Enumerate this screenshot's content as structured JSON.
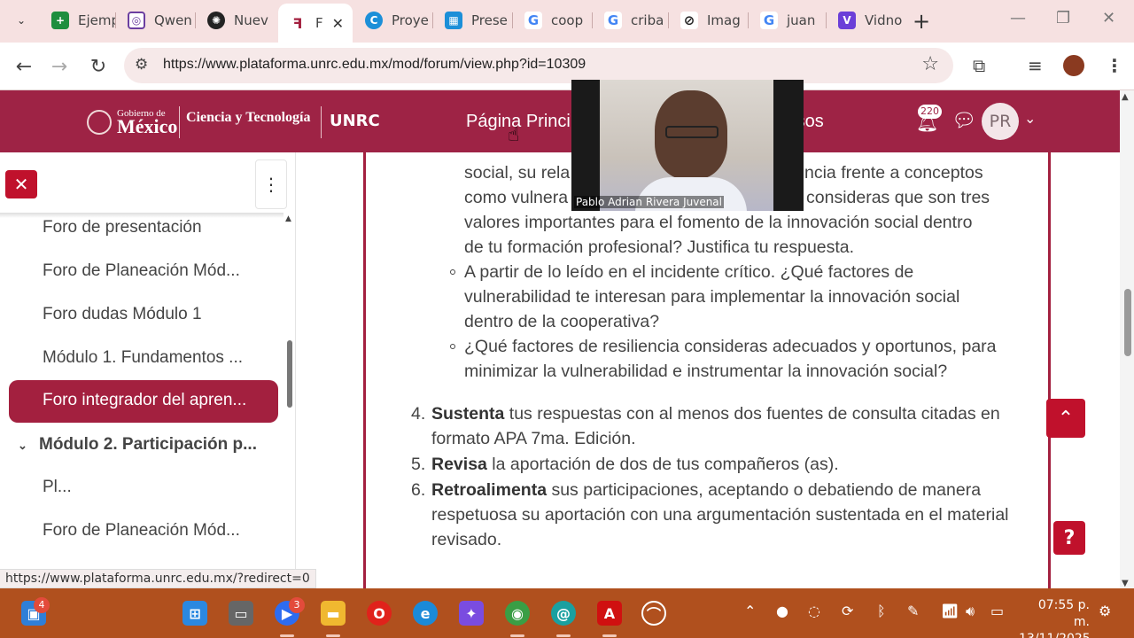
{
  "browser": {
    "tabs": [
      {
        "label": "Ejemp",
        "icon": "sheets-icon",
        "color": "#1e8e3e"
      },
      {
        "label": "Qwen",
        "icon": "qwen-icon",
        "color": "#6b3fa0"
      },
      {
        "label": "Nuev",
        "icon": "openai-icon",
        "color": "#222222"
      },
      {
        "label": "F",
        "icon": "moodle-icon",
        "color": "#a3203f"
      },
      {
        "label": "Proye",
        "icon": "canva-icon",
        "color": "#1c8fd8"
      },
      {
        "label": "Prese",
        "icon": "slides-icon",
        "color": "#1c8fd8"
      },
      {
        "label": "coop",
        "icon": "google-icon",
        "color": "#4285f4"
      },
      {
        "label": "criba",
        "icon": "google-icon",
        "color": "#4285f4"
      },
      {
        "label": "Imag",
        "icon": "slash-icon",
        "color": "#222222"
      },
      {
        "label": "juan",
        "icon": "google-icon",
        "color": "#4285f4"
      },
      {
        "label": "Vidno",
        "icon": "vidnoz-icon",
        "color": "#6b3fd8"
      }
    ],
    "active_tab_close": "✕",
    "new_tab": "+",
    "url": "https://www.plataforma.unrc.edu.mx/mod/forum/view.php?id=10309"
  },
  "site": {
    "gob_small": "Gobierno de",
    "gob_big": "México",
    "cyt": "Ciencia y Tecnología",
    "unrc": "UNRC",
    "nav_home": "Página Princi",
    "nav_courses": "rsos",
    "notifications": "220",
    "user_initials": "PR"
  },
  "drawer": {
    "close": "✕",
    "items": [
      {
        "label": "Foro de presentación"
      },
      {
        "label": "Foro de Planeación Mód..."
      },
      {
        "label": "Foro dudas Módulo 1"
      },
      {
        "label": "Módulo 1. Fundamentos ..."
      },
      {
        "label": "Foro integrador del apren..."
      },
      {
        "label": "Módulo 2. Participación p..."
      },
      {
        "label": "Pl..."
      },
      {
        "label": "Foro de Planeación Mód..."
      }
    ]
  },
  "content": {
    "bullet1_line1": "social, su rela",
    "bullet1_line1b": "ncia frente a conceptos",
    "bullet1_line2": "como vulnera",
    "bullet1_line2b": "consideras que son tres",
    "bullet1_line3": "valores importantes para el fomento de la innovación social dentro",
    "bullet1_line4": "de tu formación profesional? Justifica tu respuesta.",
    "bullet2": "A partir de lo leído en el incidente crítico. ¿Qué factores de vulnerabilidad te interesan para implementar la innovación social dentro de la cooperativa?",
    "bullet3": "¿Qué factores de resiliencia consideras adecuados y oportunos, para minimizar la vulnerabilidad e instrumentar la innovación social?",
    "steps": [
      {
        "num": "4.",
        "bold": "Sustenta",
        "text": " tus respuestas con al menos dos fuentes de consulta citadas en formato APA 7ma. Edición."
      },
      {
        "num": "5.",
        "bold": "Revisa",
        "text": " la aportación de dos de tus compañeros (as)."
      },
      {
        "num": "6.",
        "bold": "Retroalimenta",
        "text": " sus participaciones, aceptando o debatiendo de manera respetuosa su aportación con una argumentación sustentada en el material revisado."
      }
    ]
  },
  "video": {
    "participant_name": "Pablo Adrian Rivera Juvenal"
  },
  "status_url": "https://www.plataforma.unrc.edu.mx/?redirect=0",
  "taskbar": {
    "widgets_badge": "4",
    "zoom_badge": "3",
    "time": "07:55 p. m.",
    "date": "13/11/2025"
  },
  "colors": {
    "brand": "#9e2345",
    "accent_red": "#c0112c",
    "taskbar": "#b0501e",
    "tabstrip": "#f6e1e1"
  }
}
